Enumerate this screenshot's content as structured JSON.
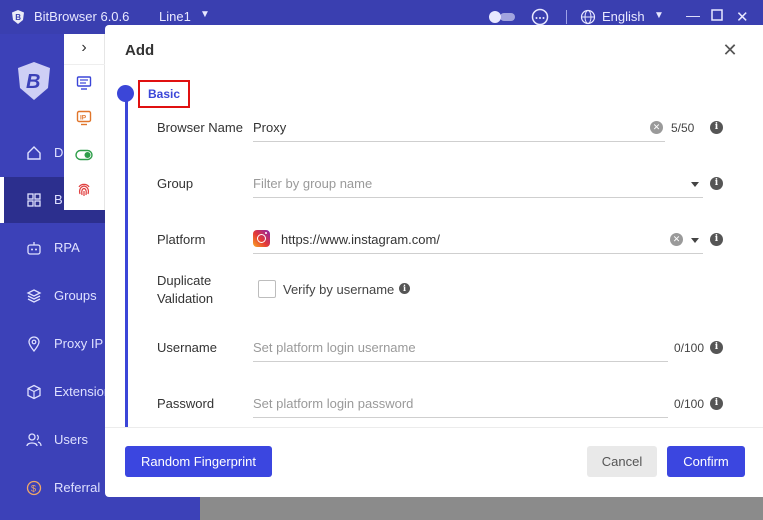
{
  "titlebar": {
    "app_title": "BitBrowser 6.0.6",
    "line_selector": "Line1",
    "language": "English",
    "theme_toggle_icon": "theme-toggle-icon",
    "support_icon": "headset-icon",
    "globe_icon": "globe-icon"
  },
  "sidebar": {
    "items": [
      {
        "label": "D",
        "icon": "home-icon"
      },
      {
        "label": "B",
        "icon": "grid-icon"
      },
      {
        "label": "RPA",
        "icon": "robot-icon"
      },
      {
        "label": "Groups",
        "icon": "layers-icon"
      },
      {
        "label": "Proxy IP",
        "icon": "location-pin-icon"
      },
      {
        "label": "Extension",
        "icon": "cube-icon"
      },
      {
        "label": "Users",
        "icon": "users-icon"
      },
      {
        "label": "Referral",
        "icon": "coin-icon"
      }
    ]
  },
  "toolbar": {
    "expand_glyph": "›",
    "buttons": [
      "monitor-icon",
      "ip-icon",
      "toggle-icon",
      "fingerprint-icon"
    ]
  },
  "modal": {
    "title": "Add",
    "close_glyph": "✕",
    "section": "Basic",
    "fields": {
      "browser_name": {
        "label": "Browser Name",
        "value": "Proxy",
        "counter": "5/50"
      },
      "group": {
        "label": "Group",
        "placeholder": "Filter by group name"
      },
      "platform": {
        "label": "Platform",
        "value": "https://www.instagram.com/"
      },
      "duplicate": {
        "label_line1": "Duplicate",
        "label_line2": "Validation",
        "checkbox_label": "Verify by username"
      },
      "username": {
        "label": "Username",
        "placeholder": "Set platform login username",
        "counter": "0/100"
      },
      "password": {
        "label": "Password",
        "placeholder": "Set platform login password",
        "counter": "0/100"
      }
    },
    "buttons": {
      "random_fingerprint": "Random Fingerprint",
      "cancel": "Cancel",
      "confirm": "Confirm"
    }
  },
  "colors": {
    "primary": "#3b46e0",
    "sidebar": "#3c41b8",
    "highlight_box": "#e01010"
  }
}
